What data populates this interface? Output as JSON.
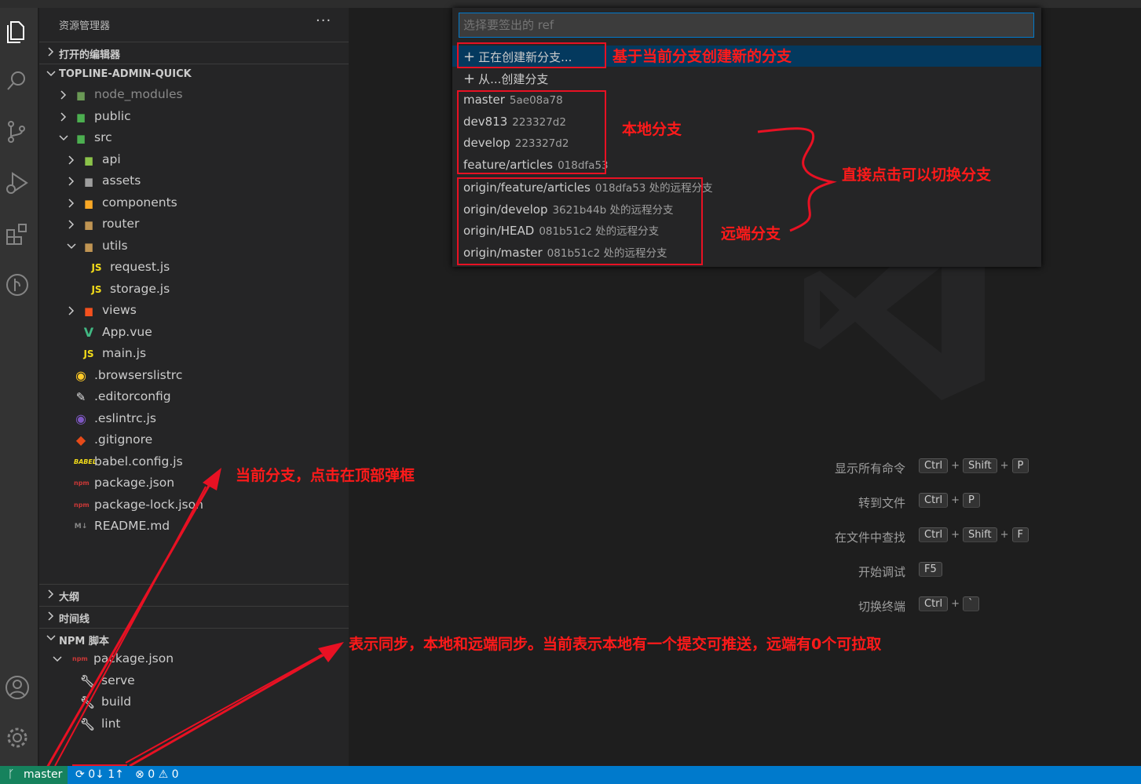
{
  "sidebar": {
    "title": "资源管理器",
    "more": "···",
    "open_editors": "打开的编辑器",
    "project": "TOPLINE-ADMIN-QUICK",
    "tree": [
      {
        "label": "node_modules"
      },
      {
        "label": "public"
      },
      {
        "label": "src"
      },
      {
        "label": "api"
      },
      {
        "label": "assets"
      },
      {
        "label": "components"
      },
      {
        "label": "router"
      },
      {
        "label": "utils"
      },
      {
        "label": "request.js"
      },
      {
        "label": "storage.js"
      },
      {
        "label": "views"
      },
      {
        "label": "App.vue"
      },
      {
        "label": "main.js"
      },
      {
        "label": ".browserslistrc"
      },
      {
        "label": ".editorconfig"
      },
      {
        "label": ".eslintrc.js"
      },
      {
        "label": ".gitignore"
      },
      {
        "label": "babel.config.js"
      },
      {
        "label": "package.json"
      },
      {
        "label": "package-lock.json"
      },
      {
        "label": "README.md"
      }
    ],
    "outline": "大纲",
    "timeline": "时间线",
    "npm": "NPM 脚本",
    "npm_package": "package.json",
    "scripts": [
      "serve",
      "build",
      "lint"
    ]
  },
  "quickpick": {
    "placeholder": "选择要签出的 ref",
    "create_new": "正在创建新分支...",
    "create_from": "从...创建分支",
    "branches": [
      {
        "name": "master",
        "desc": "5ae08a78"
      },
      {
        "name": "dev813",
        "desc": "223327d2"
      },
      {
        "name": "develop",
        "desc": "223327d2"
      },
      {
        "name": "feature/articles",
        "desc": "018dfa53"
      },
      {
        "name": "origin/feature/articles",
        "desc": "018dfa53 处的远程分支"
      },
      {
        "name": "origin/develop",
        "desc": "3621b44b 处的远程分支"
      },
      {
        "name": "origin/HEAD",
        "desc": "081b51c2 处的远程分支"
      },
      {
        "name": "origin/master",
        "desc": "081b51c2 处的远程分支"
      }
    ]
  },
  "annotations": {
    "create_branch": "基于当前分支创建新的分支",
    "local": "本地分支",
    "remote": "远端分支",
    "click_switch": "直接点击可以切换分支",
    "current_branch": "当前分支，点击在顶部弹框",
    "sync": "表示同步，本地和远端同步。当前表示本地有一个提交可推送，远端有0个可拉取"
  },
  "shortcuts": [
    {
      "label": "显示所有命令",
      "keys": [
        "Ctrl",
        "Shift",
        "P"
      ]
    },
    {
      "label": "转到文件",
      "keys": [
        "Ctrl",
        "P"
      ]
    },
    {
      "label": "在文件中查找",
      "keys": [
        "Ctrl",
        "Shift",
        "F"
      ]
    },
    {
      "label": "开始调试",
      "keys": [
        "F5"
      ]
    },
    {
      "label": "切换终端",
      "keys": [
        "Ctrl",
        "`"
      ]
    }
  ],
  "status": {
    "branch": "master",
    "sync": "0↓ 1↑",
    "errors": "0",
    "warnings": "0"
  },
  "colors": {
    "status_bar": "#007acc",
    "annotation_red": "#e81123",
    "selection": "#04395e"
  }
}
